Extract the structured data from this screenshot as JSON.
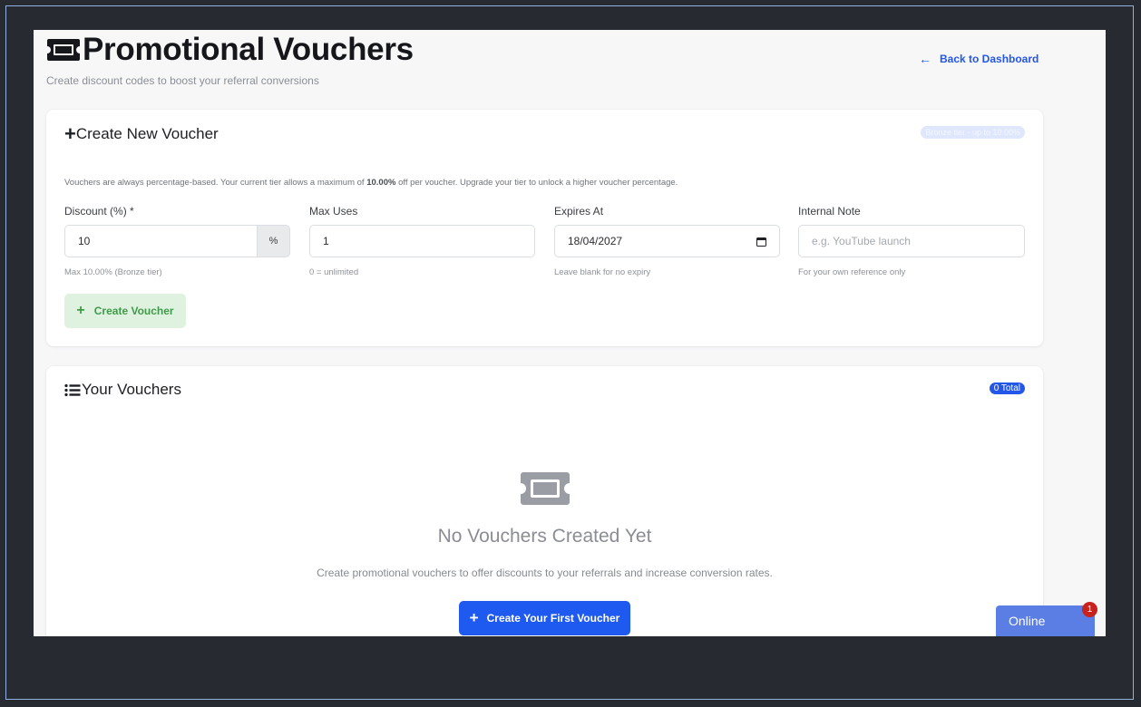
{
  "header": {
    "title": "Promotional Vouchers",
    "subtitle": "Create discount codes to boost your referral conversions",
    "back_link": "Back to Dashboard"
  },
  "create_card": {
    "title": "Create New Voucher",
    "tier_badge": "Bronze tier - up to 10.00%",
    "info_prefix": "Vouchers are always percentage-based. Your current tier allows a maximum of ",
    "info_bold": "10.00%",
    "info_suffix": " off per voucher. Upgrade your tier to unlock a higher voucher percentage.",
    "fields": [
      {
        "label": "Discount (%) *",
        "value": "10",
        "addon": "%",
        "help": "Max 10.00% (Bronze tier)"
      },
      {
        "label": "Max Uses",
        "value": "1",
        "help": "0 = unlimited"
      },
      {
        "label": "Expires At",
        "value": "18/04/2027",
        "help": "Leave blank for no expiry"
      },
      {
        "label": "Internal Note",
        "placeholder": "e.g. YouTube launch",
        "help": "For your own reference only"
      }
    ],
    "create_button": "Create Voucher"
  },
  "list_card": {
    "title": "Your Vouchers",
    "total_badge": "0 Total",
    "empty_title": "No Vouchers Created Yet",
    "empty_desc": "Create promotional vouchers to offer discounts to your referrals and increase conversion rates.",
    "first_button": "Create Your First Voucher"
  },
  "chat_widget": {
    "label": "Online",
    "unread_count": "1"
  },
  "colors": {
    "accent": "#2456e8",
    "success_bg": "#dff2e0",
    "success_text": "#3f9a49",
    "chat_widget": "#5b7ee5",
    "badge_red": "#c8211e"
  }
}
